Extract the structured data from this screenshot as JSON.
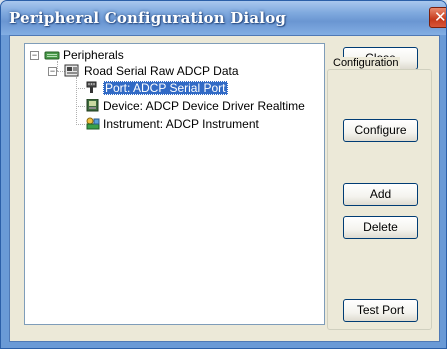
{
  "window": {
    "title": "Peripheral Configuration Dialog",
    "close_glyph": "✕"
  },
  "tree": {
    "nodes": [
      {
        "label": "Peripherals",
        "icon": "peripherals-icon",
        "expander": "−"
      },
      {
        "label": "Road Serial Raw ADCP Data",
        "icon": "data-source-icon",
        "expander": "−"
      },
      {
        "label": "Port: ADCP Serial Port",
        "icon": "serial-port-icon",
        "selected": true
      },
      {
        "label": "Device: ADCP Device Driver Realtime",
        "icon": "device-driver-icon"
      },
      {
        "label": "Instrument: ADCP Instrument",
        "icon": "instrument-icon"
      }
    ]
  },
  "buttons": {
    "close": "Close",
    "configure": "Configure",
    "add": "Add",
    "delete": "Delete",
    "test_port": "Test Port"
  },
  "groupbox": {
    "label": "Configuration"
  },
  "colors": {
    "selection": "#316ac5",
    "titlebar": "#7fa9de",
    "dialog_face": "#ece9d8"
  }
}
